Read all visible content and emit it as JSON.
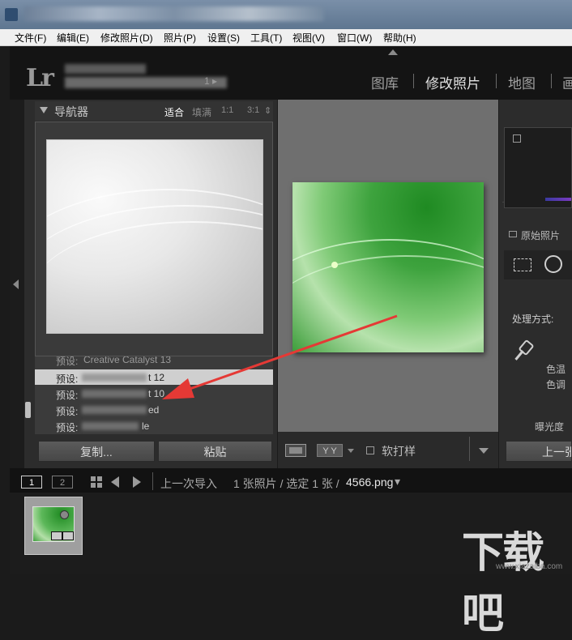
{
  "menubar": {
    "items": [
      "文件(F)",
      "编辑(E)",
      "修改照片(D)",
      "照片(P)",
      "设置(S)",
      "工具(T)",
      "视图(V)",
      "窗口(W)",
      "帮助(H)"
    ]
  },
  "logo": "Lr",
  "identity_suffix": "1 ▸",
  "modules": [
    "图库",
    "修改照片",
    "地图",
    "画"
  ],
  "navigator": {
    "title": "导航器",
    "zoom_options": [
      "适合",
      "填满",
      "1:1",
      "3:1"
    ],
    "zoom_arrow": "⇕"
  },
  "presets": {
    "items": [
      {
        "prefix": "预设:",
        "suffix": "Creative Catalyst 13"
      },
      {
        "prefix": "预设:",
        "suffix": "t 12"
      },
      {
        "prefix": "预设:",
        "suffix": "t 10"
      },
      {
        "prefix": "预设:",
        "suffix": "ed"
      },
      {
        "prefix": "预设:",
        "suffix": "le"
      }
    ]
  },
  "left_buttons": {
    "copy": "复制...",
    "paste": "粘贴"
  },
  "center_toolbar": {
    "yy_label": "Y Y",
    "softproof_label": "软打样"
  },
  "right_panel": {
    "original_label": "原始照片",
    "treatment_label": "处理方式:",
    "temp_label": "色温",
    "tint_label": "色调",
    "exposure_label": "曝光度",
    "prev_button": "上一张"
  },
  "filmbar": {
    "page1": "1",
    "page2": "2",
    "source": "上一次导入",
    "count": "1 张照片 / 选定 1 张 /",
    "filename": "4566.png",
    "dropdown": "▾"
  },
  "watermark": {
    "main": "下载吧",
    "sub": "www.xiazaiba.com"
  },
  "colors": {
    "accent_arrow": "#e53935",
    "panel": "#2c2c2c",
    "center_bg": "#6f6f6f"
  }
}
